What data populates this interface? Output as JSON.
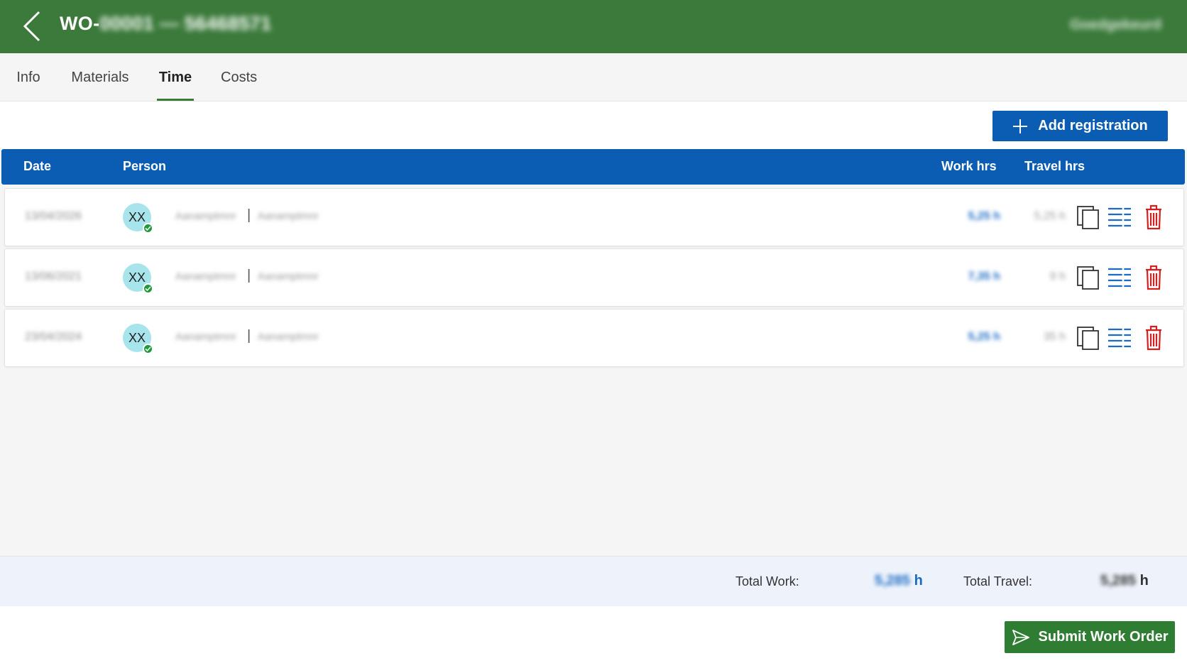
{
  "header": {
    "title_prefix": "WO-",
    "title_hidden": "00001 — 56468571",
    "right_text": "Goedgekeurd"
  },
  "tabs": [
    {
      "label": "Info"
    },
    {
      "label": "Materials"
    },
    {
      "label": "Time",
      "active": true
    },
    {
      "label": "Costs"
    }
  ],
  "toolbar": {
    "add_label": "Add registration"
  },
  "table": {
    "headers": {
      "date": "Date",
      "person": "Person",
      "work": "Work hrs",
      "travel": "Travel hrs"
    },
    "rows": [
      {
        "date": "13/04/2026",
        "initials": "XX",
        "name_a": "Aanamptmnr",
        "separator": "|",
        "name_b": "Aanamptmnr",
        "work": "5,25 h",
        "travel": "5,25 h"
      },
      {
        "date": "13/06/2021",
        "initials": "XX",
        "name_a": "Aanamptmnr",
        "separator": "|",
        "name_b": "Aanamptmnr",
        "work": "7,35 h",
        "travel": "9 h"
      },
      {
        "date": "23/04/2024",
        "initials": "XX",
        "name_a": "Aanamptmnr",
        "separator": "|",
        "name_b": "Aanamptmnr",
        "work": "5,25 h",
        "travel": "35 h"
      }
    ]
  },
  "totals": {
    "work_label": "Total Work:",
    "work_value": "5,285",
    "work_unit": "h",
    "travel_label": "Total Travel:",
    "travel_value": "5,285",
    "travel_unit": "h"
  },
  "footer": {
    "submit_label": "Submit Work Order"
  },
  "colors": {
    "header_bg": "#3b7a3b",
    "primary_blue": "#0b5db3",
    "submit_green": "#2e7d32",
    "delete_red": "#d32020"
  },
  "icons": {
    "back": "chevron-left-icon",
    "add": "plus-icon",
    "copy": "copy-icon",
    "details": "list-icon",
    "delete": "trash-icon",
    "status": "check-badge-icon",
    "submit": "send-icon"
  }
}
